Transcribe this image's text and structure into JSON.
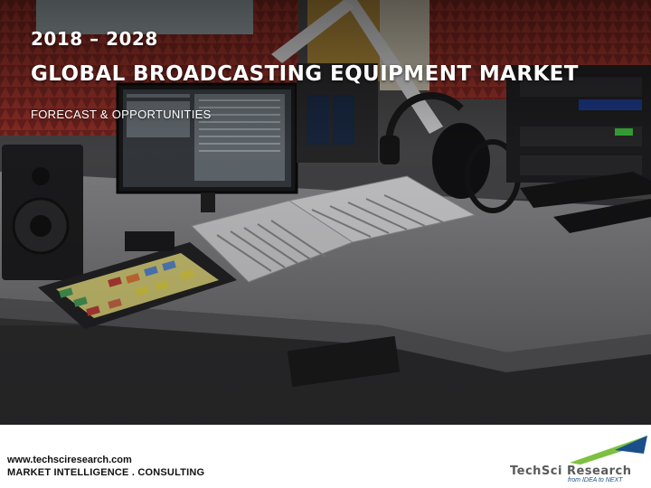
{
  "header": {
    "years": "2018 – 2028",
    "title": "GLOBAL BROADCASTING EQUIPMENT MARKET",
    "subtitle": "FORECAST & OPPORTUNITIES"
  },
  "footer": {
    "website": "www.techsciresearch.com",
    "tagline": "MARKET INTELLIGENCE . CONSULTING",
    "logo_name": "TechSci Research",
    "logo_tagline": "from IDEA to NEXT"
  },
  "colors": {
    "logo_green": "#7cc142",
    "logo_blue": "#1a4f8a",
    "foam_red": "#8c2a22"
  }
}
